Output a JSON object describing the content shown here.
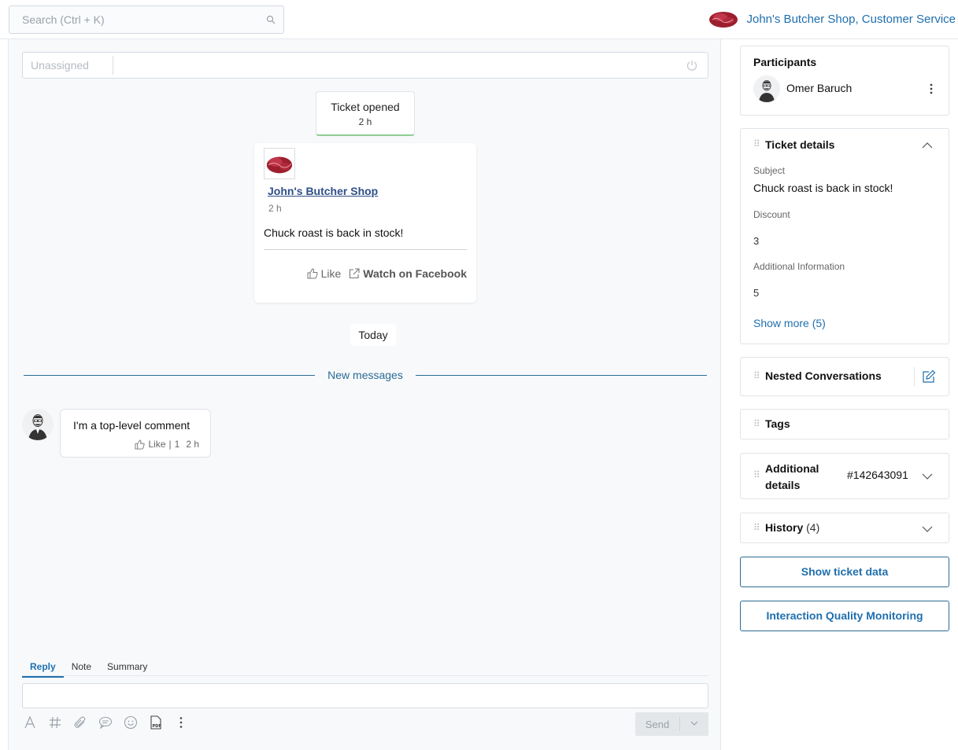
{
  "header": {
    "search_placeholder": "Search (Ctrl + K)",
    "account_name": "John's Butcher Shop, Customer Service"
  },
  "assignee": {
    "placeholder": "Unassigned"
  },
  "timeline": {
    "ticket_opened": {
      "label": "Ticket opened",
      "time": "2 h"
    },
    "post": {
      "author": "John's Butcher Shop",
      "time": "2 h",
      "body": "Chuck roast is back in stock!",
      "like_label": "Like",
      "watch_label": "Watch on Facebook"
    },
    "day_label": "Today",
    "new_messages_label": "New messages",
    "comment": {
      "text": "I'm a top-level comment",
      "like_label": "Like",
      "separator": "|",
      "like_count": "1",
      "time": "2 h"
    }
  },
  "composer": {
    "tabs": [
      {
        "label": "Reply",
        "active": true
      },
      {
        "label": "Note",
        "active": false
      },
      {
        "label": "Summary",
        "active": false
      }
    ],
    "send_label": "Send",
    "toolbar_icons": [
      "format-icon",
      "hashtag-icon",
      "attachment-icon",
      "template-icon",
      "emoji-icon",
      "pdf-icon",
      "more-icon"
    ]
  },
  "sidebar": {
    "participants": {
      "title": "Participants",
      "name": "Omer Baruch"
    },
    "ticket_details": {
      "title": "Ticket details",
      "subject_label": "Subject",
      "subject_value": "Chuck roast is back in stock!",
      "discount_label": "Discount",
      "discount_value": "3",
      "additional_info_label": "Additional Information",
      "additional_info_value": "5",
      "show_more": "Show more (5)"
    },
    "nested_conversations": {
      "title": "Nested Conversations"
    },
    "tags": {
      "title": "Tags"
    },
    "additional_details": {
      "title_line1": "Additional",
      "title_line2": "details",
      "ticket_id": "#142643091"
    },
    "history": {
      "title": "History",
      "count": "(4)"
    },
    "show_ticket_data": "Show ticket data",
    "quality_monitoring": "Interaction Quality Monitoring"
  },
  "colors": {
    "accent": "#1f6fae",
    "divider_blue": "#2c6b95",
    "opened_border": "#8fcd94"
  }
}
